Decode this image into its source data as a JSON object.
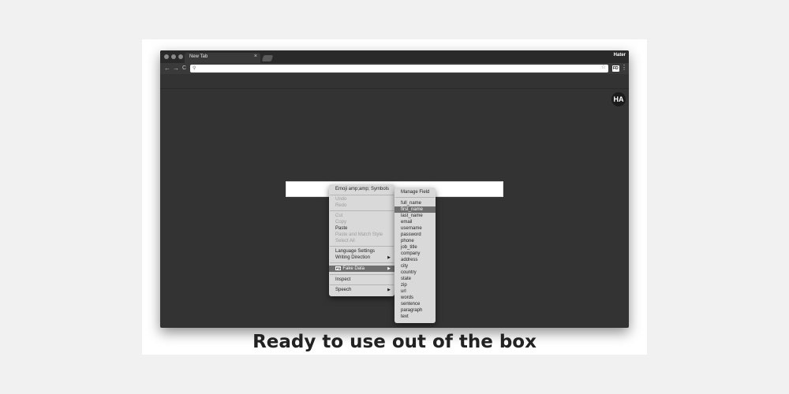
{
  "tab": {
    "title": "New Tab",
    "close": "×"
  },
  "profile": "Hater",
  "nav": {
    "back": "←",
    "forward": "→",
    "reload": "C"
  },
  "omnibox": {
    "value": "",
    "search_icon": "⚲",
    "star_icon": "☆"
  },
  "extension_badge": "FD",
  "menu_icon": "⋮",
  "logo": "HA",
  "context_menu": {
    "items": [
      {
        "label": "Emoji amp;amp; Symbols",
        "disabled": false
      },
      {
        "label": "Undo",
        "disabled": true
      },
      {
        "label": "Redo",
        "disabled": true
      },
      {
        "label": "Cut",
        "disabled": true
      },
      {
        "label": "Copy",
        "disabled": true
      },
      {
        "label": "Paste",
        "disabled": false
      },
      {
        "label": "Paste and Match Style",
        "disabled": true
      },
      {
        "label": "Select All",
        "disabled": true
      },
      {
        "label": "Language Settings",
        "disabled": false
      },
      {
        "label": "Writing Direction",
        "disabled": false,
        "arrow": "▶"
      },
      {
        "label": "Fake Data",
        "badge": "FD",
        "disabled": false,
        "active": true,
        "arrow": "▶"
      },
      {
        "label": "Inspect",
        "disabled": false
      },
      {
        "label": "Speech",
        "disabled": false,
        "arrow": "▶"
      }
    ]
  },
  "submenu": {
    "header": "Manage Field",
    "items": [
      "full_name",
      "first_name",
      "last_name",
      "email",
      "username",
      "password",
      "phone",
      "job_title",
      "company",
      "address",
      "city",
      "country",
      "state",
      "zip",
      "url",
      "words",
      "sentence",
      "paragraph",
      "text"
    ],
    "selected": "first_name"
  },
  "caption": "Ready to use out of the box",
  "colors": {
    "window": "#333333",
    "titlebar": "#2a2a2a",
    "menu": "#d9d9d9",
    "highlight": "#6f6f6f"
  }
}
